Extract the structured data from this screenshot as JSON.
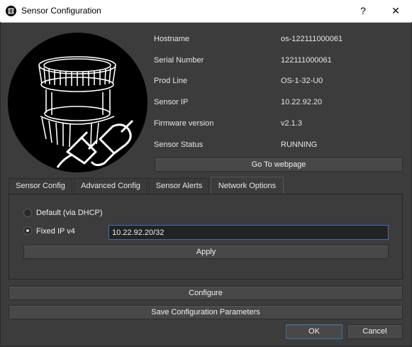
{
  "window": {
    "title": "Sensor Configuration",
    "help_glyph": "?",
    "close_glyph": "✕"
  },
  "info": {
    "rows": [
      {
        "label": "Hostname",
        "value": "os-122111000061"
      },
      {
        "label": "Serial Number",
        "value": "122111000061"
      },
      {
        "label": "Prod Line",
        "value": "OS-1-32-U0"
      },
      {
        "label": "Sensor IP",
        "value": "10.22.92.20"
      },
      {
        "label": "Firmware version",
        "value": "v2.1.3"
      },
      {
        "label": "Sensor Status",
        "value": "RUNNING"
      }
    ]
  },
  "buttons": {
    "webpage": "Go To webpage",
    "apply": "Apply",
    "configure": "Configure",
    "save": "Save Configuration Parameters",
    "ok": "OK",
    "cancel": "Cancel"
  },
  "tabs": [
    {
      "label": "Sensor Config",
      "active": false
    },
    {
      "label": "Advanced Config",
      "active": false
    },
    {
      "label": "Sensor Alerts",
      "active": false
    },
    {
      "label": "Network Options",
      "active": true
    }
  ],
  "network": {
    "dhcp_label": "Default (via DHCP)",
    "fixed_label": "Fixed IP v4",
    "selected": "fixed",
    "ip_value": "10.22.92.20/32"
  },
  "colors": {
    "background": "#3c3c3c",
    "focus_border": "#3f6fa8"
  },
  "icons": {
    "app": "sensor-logo-icon",
    "logo": "sensor-with-plug-icon"
  }
}
